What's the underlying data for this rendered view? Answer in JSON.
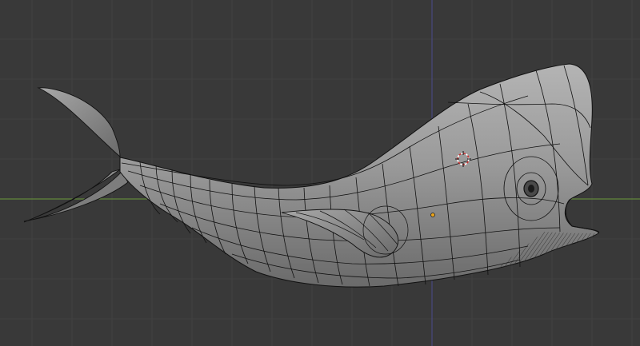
{
  "viewport": {
    "view": "3D Viewport",
    "shading": "solid",
    "mode": "edit",
    "object": "whale-mesh",
    "colors": {
      "background": "#393939",
      "grid": "#414141",
      "x_axis": "#6a9a3a",
      "z_axis": "#4a4a8a",
      "mesh_fill": "#8e8e8e",
      "mesh_wire": "#111111",
      "origin": "#e8a21a",
      "cursor_red": "#d03030",
      "cursor_white": "#ffffff"
    },
    "elements": [
      "grid",
      "x-axis",
      "z-axis",
      "whale-mesh",
      "3d-cursor",
      "object-origin"
    ]
  }
}
